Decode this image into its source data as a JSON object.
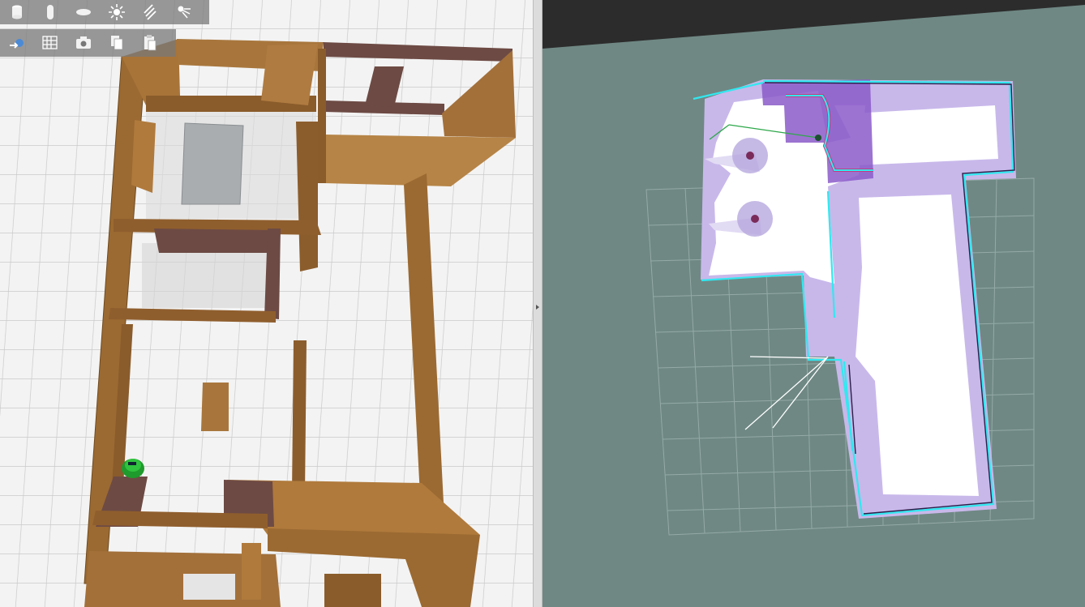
{
  "gazebo": {
    "toolbar_row1": [
      {
        "name": "cylinder-shape-button",
        "icon": "cylinder-icon"
      },
      {
        "name": "capsule-shape-button",
        "icon": "capsule-icon"
      },
      {
        "name": "ellipsoid-shape-button",
        "icon": "ellipsoid-icon"
      },
      {
        "name": "point-light-button",
        "icon": "sun-icon"
      },
      {
        "name": "directional-light-button",
        "icon": "directional-light-icon"
      },
      {
        "name": "spot-light-button",
        "icon": "spot-light-icon"
      }
    ],
    "toolbar_row2": [
      {
        "name": "orbit-view-button",
        "icon": "orbit-icon"
      },
      {
        "name": "grid-snap-button",
        "icon": "grid-icon"
      },
      {
        "name": "screenshot-button",
        "icon": "camera-icon"
      },
      {
        "name": "copy-button",
        "icon": "copy-icon"
      },
      {
        "name": "paste-button",
        "icon": "paste-icon"
      }
    ],
    "colors": {
      "floor": "#f3f3f3",
      "wood": "#9b6a32",
      "brick": "#6d4a44",
      "robot": "#1f9a2c"
    }
  },
  "rviz": {
    "colors": {
      "background": "#6f8884",
      "free": "#ffffff",
      "inflation": "#c8b8ea",
      "lethal": "#5b2aa8",
      "obstacle": "#31e8f0",
      "grid": "#94aaa6"
    }
  }
}
